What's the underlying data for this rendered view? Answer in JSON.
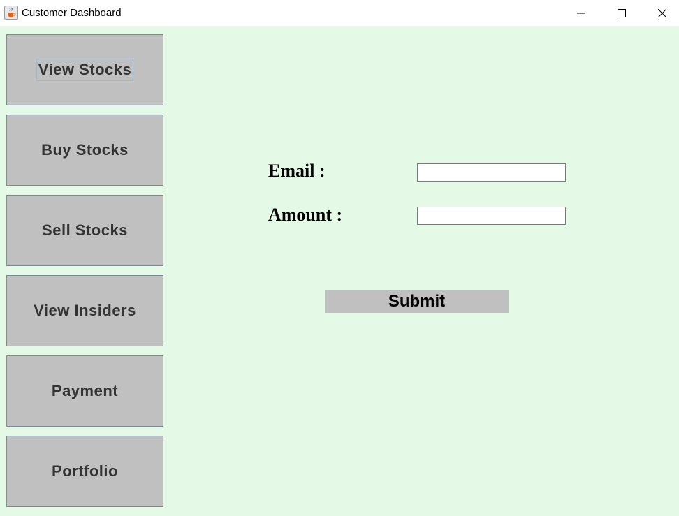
{
  "window": {
    "title": "Customer Dashboard",
    "icon": "java-cup-icon",
    "controls": [
      "minimize-icon",
      "maximize-icon",
      "close-icon"
    ]
  },
  "sidebar": {
    "items": [
      {
        "label": "View Stocks",
        "focused": true
      },
      {
        "label": "Buy Stocks"
      },
      {
        "label": "Sell Stocks"
      },
      {
        "label": "View Insiders"
      },
      {
        "label": "Payment"
      },
      {
        "label": "Portfolio"
      }
    ]
  },
  "form": {
    "email_label": "Email :",
    "email_value": "",
    "amount_label": "Amount :",
    "amount_value": "",
    "submit_label": "Submit"
  },
  "colors": {
    "background": "#e5fae6",
    "button": "#c0c0c0",
    "button_text": "#333333"
  }
}
